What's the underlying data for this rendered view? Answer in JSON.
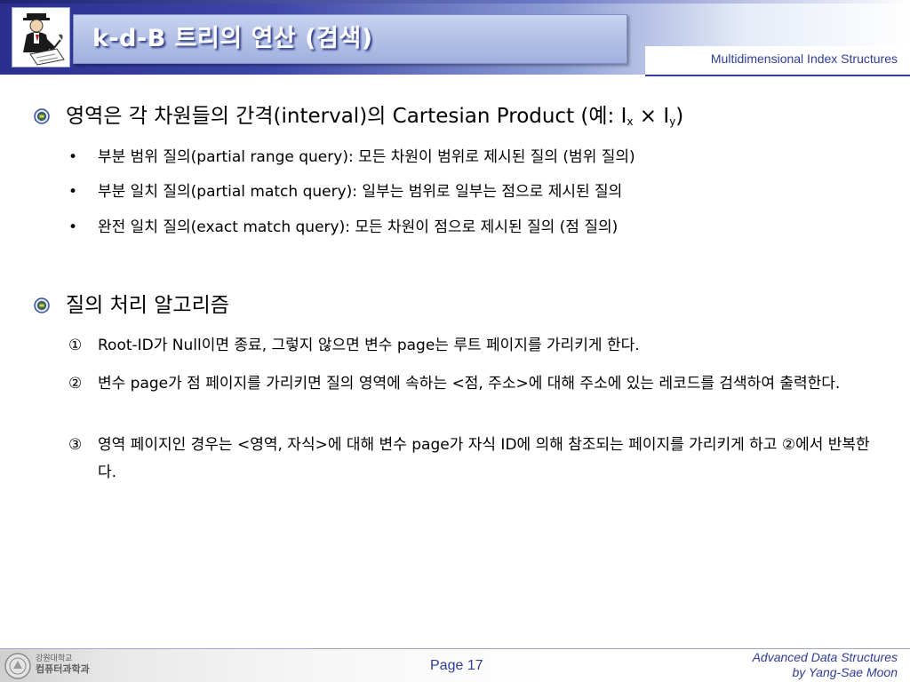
{
  "header": {
    "title": "k-d-B 트리의 연산 (검색)",
    "subtitle": "Multidimensional Index Structures"
  },
  "content": {
    "bullet1": {
      "pre": "영역은 각 차원들의 간격(interval)의 Cartesian Product (예: I",
      "sub_x": "x",
      "mid": " × I",
      "sub_y": "y",
      "post": ")",
      "items": [
        "부분 범위 질의(partial range query): 모든 차원이 범위로 제시된 질의 (범위 질의)",
        "부분 일치 질의(partial match query): 일부는 범위로 일부는 점으로 제시된 질의",
        "완전 일치 질의(exact match query): 모든 차원이 점으로 제시된 질의 (점 질의)"
      ]
    },
    "bullet2": {
      "text": "질의 처리 알고리즘",
      "steps": [
        {
          "num": "①",
          "text": "Root-ID가 Null이면 종료, 그렇지 않으면 변수 page는 루트 페이지를 가리키게 한다."
        },
        {
          "num": "②",
          "text": "변수 page가 점 페이지를 가리키면 질의 영역에 속하는 <점, 주소>에 대해 주소에 있는 레코드를 검색하여 출력한다."
        },
        {
          "num": "③",
          "text": "영역 페이지인 경우는 <영역, 자식>에 대해 변수 page가 자식 ID에 의해 참조되는 페이지를 가리키게 하고 ②에서 반복한다."
        }
      ]
    }
  },
  "footer": {
    "university_line1": "강원대학교",
    "university_line2": "컴퓨터과학과",
    "page": "Page 17",
    "credit_line1": "Advanced Data Structures",
    "credit_line2": "by Yang-Sae Moon"
  },
  "colors": {
    "header_blue": "#2a2f8e",
    "accent_text": "#2f3c9a"
  }
}
